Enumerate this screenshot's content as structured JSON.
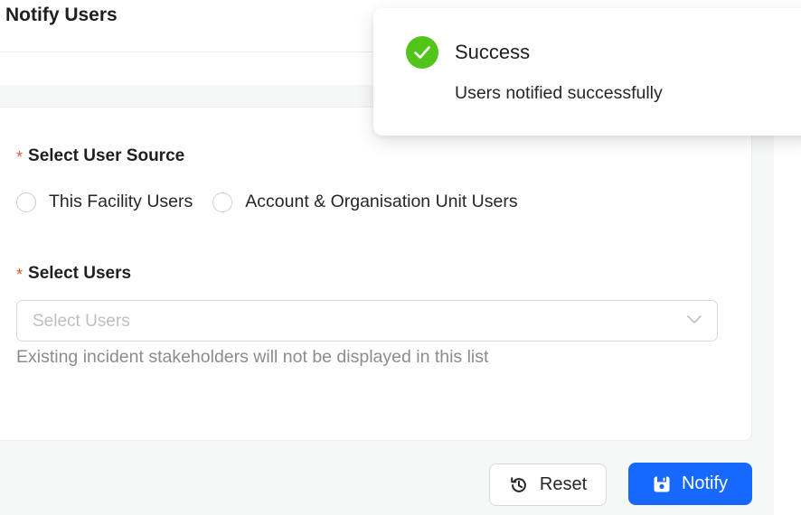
{
  "header": {
    "title": "Notify Users"
  },
  "form": {
    "user_source": {
      "required_mark": "*",
      "label": "Select User Source",
      "options": [
        {
          "label": "This Facility Users",
          "selected": false
        },
        {
          "label": "Account & Organisation Unit Users",
          "selected": false
        }
      ]
    },
    "users": {
      "required_mark": "*",
      "label": "Select Users",
      "placeholder": "Select Users",
      "help_text": "Existing incident stakeholders will not be displayed in this list"
    }
  },
  "actions": {
    "reset_label": "Reset",
    "notify_label": "Notify"
  },
  "toast": {
    "title": "Success",
    "message": "Users notified successfully",
    "icon": "check-circle-icon"
  },
  "colors": {
    "primary": "#1668ff",
    "success": "#52c41a",
    "required": "#e05a36"
  }
}
